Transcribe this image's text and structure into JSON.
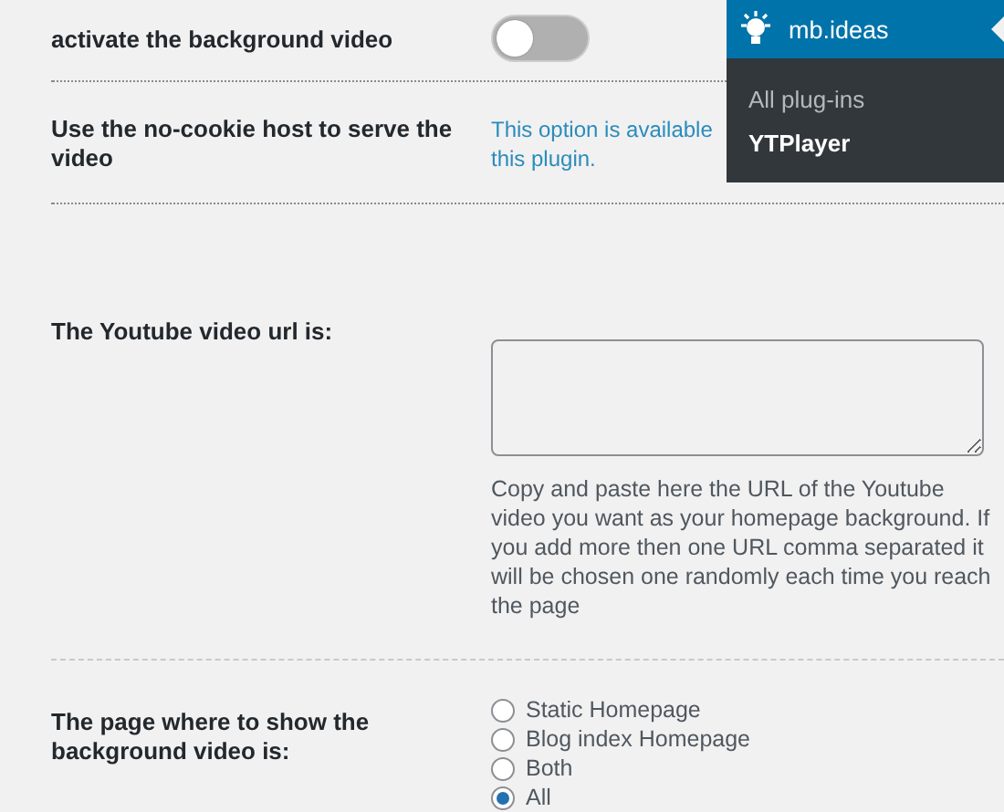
{
  "settings": [
    {
      "kind": "toggle",
      "label": "activate the background video",
      "on": false
    },
    {
      "kind": "link",
      "label": "Use the no-cookie host to serve the video",
      "lines": [
        "This option is available",
        "this plugin."
      ]
    },
    {
      "kind": "textarea",
      "label": "The Youtube video url is:",
      "description": "Copy and paste here the URL of the Youtube video you want as your homepage background. If you add more then one URL comma separated it will be chosen one randomly each time you reach the page"
    },
    {
      "kind": "radio",
      "label": "The page where to show the background video is:",
      "options": [
        {
          "label": "Static Homepage",
          "selected": false
        },
        {
          "label": "Blog index Homepage",
          "selected": false
        },
        {
          "label": "Both",
          "selected": false
        },
        {
          "label": "All",
          "selected": true
        }
      ]
    }
  ],
  "menu": {
    "title": "mb.ideas",
    "items": [
      {
        "label": "All plug-ins",
        "selected": false
      },
      {
        "label": "YTPlayer",
        "selected": true
      }
    ]
  }
}
